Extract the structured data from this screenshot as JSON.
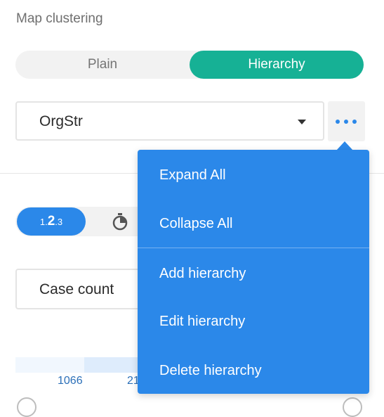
{
  "section": {
    "title": "Map clustering"
  },
  "clustering_toggle": {
    "options": [
      "Plain",
      "Hierarchy"
    ],
    "selected": "Hierarchy"
  },
  "hierarchy_select": {
    "value": "OrgStr"
  },
  "number_format": {
    "active_label": {
      "small1": "1.",
      "big": "2",
      "small2": ".3"
    },
    "icons": [
      "stopwatch-icon"
    ]
  },
  "metric_select": {
    "value": "Case count"
  },
  "legend": {
    "labels": [
      "1066",
      "21"
    ]
  },
  "menu": {
    "items": [
      "Expand All",
      "Collapse All",
      "Add hierarchy",
      "Edit hierarchy",
      "Delete hierarchy"
    ]
  },
  "colors": {
    "accent_green": "#16b195",
    "accent_blue": "#2b88e9",
    "menu_bg": "#2b88e9"
  }
}
